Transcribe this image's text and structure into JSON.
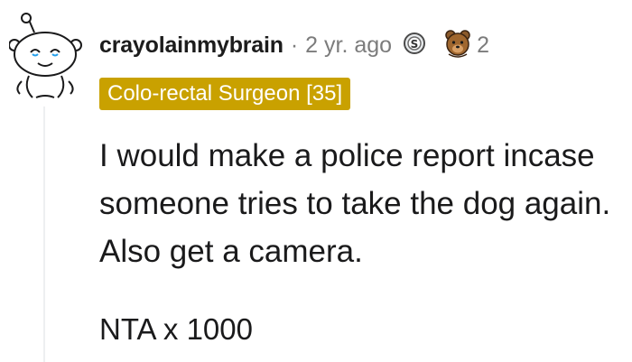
{
  "comment": {
    "username": "crayolainmybrain",
    "separator": "·",
    "timestamp": "2 yr. ago",
    "awards": [
      {
        "icon": "silver-award-icon",
        "count": ""
      },
      {
        "icon": "bear-award-icon",
        "count": "2"
      }
    ],
    "flair": "Colo-rectal Surgeon [35]",
    "paragraphs": [
      "I would make a police report incase someone tries to take the dog again. Also get a camera.",
      "NTA x 1000"
    ]
  },
  "colors": {
    "flair_background": "#c9a100",
    "flair_text": "#ffffff",
    "meta_text": "#7c7c7c",
    "thread_line": "#edeff1"
  }
}
